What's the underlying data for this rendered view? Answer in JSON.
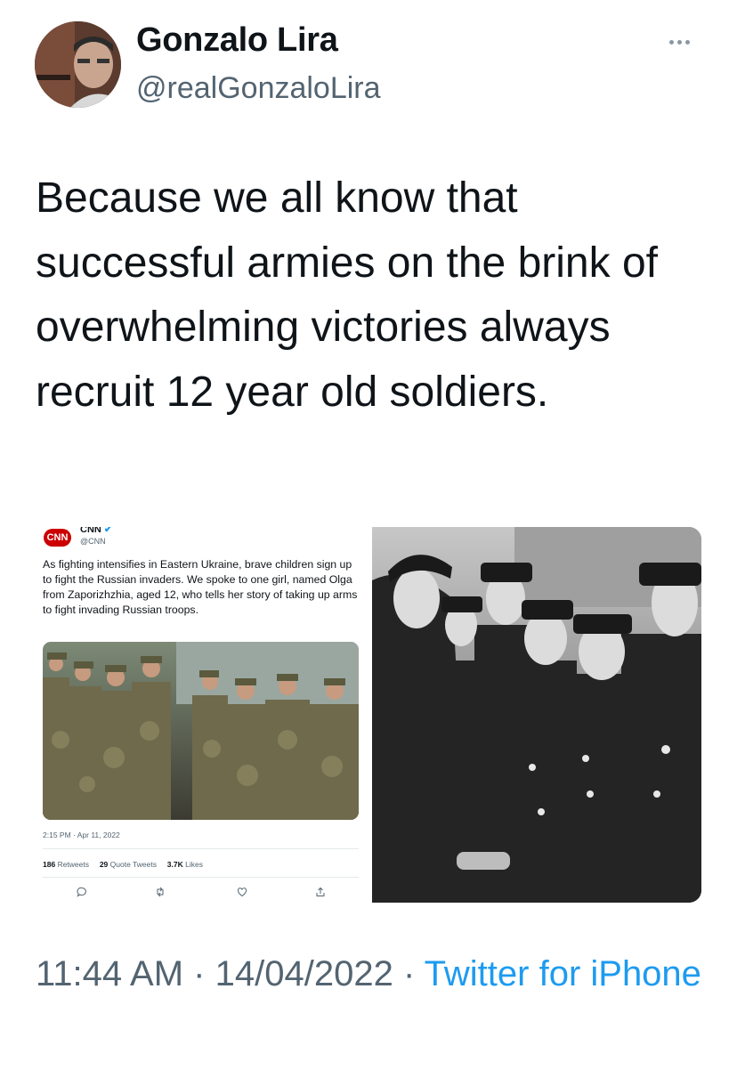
{
  "tweet": {
    "display_name": "Gonzalo Lira",
    "handle": "@realGonzaloLira",
    "text": "Because we all know that successful armies on the brink of overwhelming victories always recruit 12 year old soldiers.",
    "time": "11:44 AM",
    "date": "14/04/2022",
    "separator": "·",
    "source": "Twitter for iPhone",
    "more_icon": "more-horizontal-icon"
  },
  "embedded_tweet": {
    "logo_text": "CNN",
    "name": "CNN",
    "handle": "@CNN",
    "more": "···",
    "text": "As fighting intensifies in Eastern Ukraine, brave children sign up to fight the Russian invaders. We spoke to one girl, named Olga from Zaporizhzhia, aged 12, who tells her story of taking up arms to fight invading Russian troops.",
    "timestamp": "2:15 PM · Apr 11, 2022",
    "retweets_count": "186",
    "retweets_label": "Retweets",
    "quotes_count": "29",
    "quotes_label": "Quote Tweets",
    "likes_count": "3.7K",
    "likes_label": "Likes",
    "actions": [
      "reply-icon",
      "retweet-icon",
      "like-icon",
      "share-icon"
    ]
  },
  "colors": {
    "text": "#0f1419",
    "secondary": "#536471",
    "link": "#1d9bf0",
    "cnn_red": "#cc0000"
  }
}
